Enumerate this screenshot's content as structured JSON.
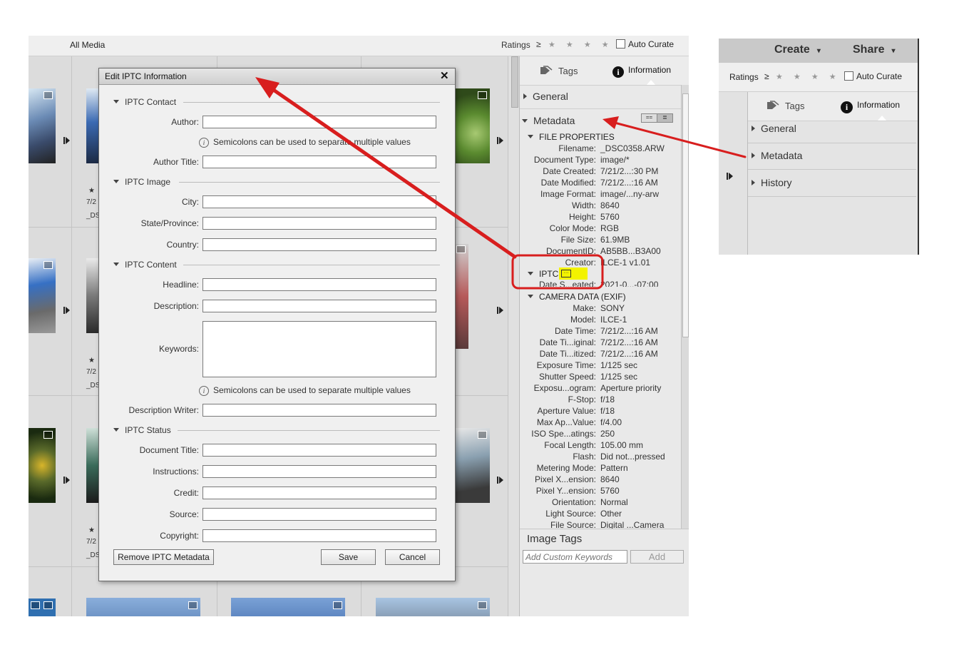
{
  "topbar": {
    "all_media": "All Media",
    "ratings": "Ratings",
    "ratings_op": "≥",
    "stars": "★ ★ ★ ★ ★",
    "auto_curate": "Auto Curate"
  },
  "grid": {
    "date_prefix": "7/2",
    "file_prefix": "_DS",
    "star": "★"
  },
  "panel": {
    "tab_tags": "Tags",
    "tab_information": "Information",
    "general": "General",
    "metadata": "Metadata",
    "file_properties": "FILE PROPERTIES",
    "file_props": [
      {
        "k": "Filename:",
        "v": "_DSC0358.ARW"
      },
      {
        "k": "Document Type:",
        "v": "image/*"
      },
      {
        "k": "Date Created:",
        "v": "7/21/2...:30 PM"
      },
      {
        "k": "Date Modified:",
        "v": "7/21/2...:16 AM"
      },
      {
        "k": "Image Format:",
        "v": "image/...ny-arw"
      },
      {
        "k": "Width:",
        "v": "8640"
      },
      {
        "k": "Height:",
        "v": "5760"
      },
      {
        "k": "Color Mode:",
        "v": "RGB"
      },
      {
        "k": "File Size:",
        "v": "61.9MB"
      },
      {
        "k": "DocumentID:",
        "v": "AB5BB...B3A00"
      },
      {
        "k": "Creator:",
        "v": "ILCE-1 v1.01"
      }
    ],
    "iptc": "IPTC",
    "iptc_props": [
      {
        "k": "Date S...eated:",
        "v": "2021-0...-07:00"
      }
    ],
    "camera_data": "CAMERA DATA (EXIF)",
    "camera_props": [
      {
        "k": "Make:",
        "v": "SONY"
      },
      {
        "k": "Model:",
        "v": "ILCE-1"
      },
      {
        "k": "Date Time:",
        "v": "7/21/2...:16 AM"
      },
      {
        "k": "Date Ti...iginal:",
        "v": "7/21/2...:16 AM"
      },
      {
        "k": "Date Ti...itized:",
        "v": "7/21/2...:16 AM"
      },
      {
        "k": "Exposure Time:",
        "v": "1/125 sec"
      },
      {
        "k": "Shutter Speed:",
        "v": "1/125 sec"
      },
      {
        "k": "Exposu...ogram:",
        "v": "Aperture priority"
      },
      {
        "k": "F-Stop:",
        "v": "f/18"
      },
      {
        "k": "Aperture Value:",
        "v": "f/18"
      },
      {
        "k": "Max Ap...Value:",
        "v": "f/4.00"
      },
      {
        "k": "ISO Spe...atings:",
        "v": "250"
      },
      {
        "k": "Focal Length:",
        "v": "105.00 mm"
      },
      {
        "k": "Flash:",
        "v": "Did not...pressed"
      },
      {
        "k": "Metering Mode:",
        "v": "Pattern"
      },
      {
        "k": "Pixel X...ension:",
        "v": "8640"
      },
      {
        "k": "Pixel Y...ension:",
        "v": "5760"
      },
      {
        "k": "Orientation:",
        "v": "Normal"
      },
      {
        "k": "Light Source:",
        "v": "Other"
      },
      {
        "k": "File Source:",
        "v": "Digital ...Camera"
      }
    ],
    "image_tags": "Image Tags",
    "add_keywords_placeholder": "Add Custom Keywords",
    "add_button": "Add"
  },
  "dialog": {
    "title": "Edit IPTC Information",
    "close": "✕",
    "groups": {
      "contact": "IPTC Contact",
      "image": "IPTC Image",
      "content": "IPTC Content",
      "status": "IPTC Status"
    },
    "labels": {
      "author": "Author:",
      "author_title": "Author Title:",
      "city": "City:",
      "state": "State/Province:",
      "country": "Country:",
      "headline": "Headline:",
      "description": "Description:",
      "keywords": "Keywords:",
      "description_writer": "Description Writer:",
      "document_title": "Document Title:",
      "instructions": "Instructions:",
      "credit": "Credit:",
      "source": "Source:",
      "copyright": "Copyright:"
    },
    "hint": "Semicolons can be used to separate multiple values",
    "remove_button": "Remove IPTC Metadata",
    "save_button": "Save",
    "cancel_button": "Cancel"
  },
  "crop": {
    "create": "Create",
    "share": "Share",
    "ratings": "Ratings",
    "ratings_op": "≥",
    "stars": "★ ★ ★ ★ ★",
    "auto_curate": "Auto Curate",
    "tab_tags": "Tags",
    "tab_information": "Information",
    "general": "General",
    "metadata": "Metadata",
    "history": "History"
  },
  "colors": {
    "annotation_red": "#d81e1e",
    "highlight_yellow": "#f3f300"
  }
}
